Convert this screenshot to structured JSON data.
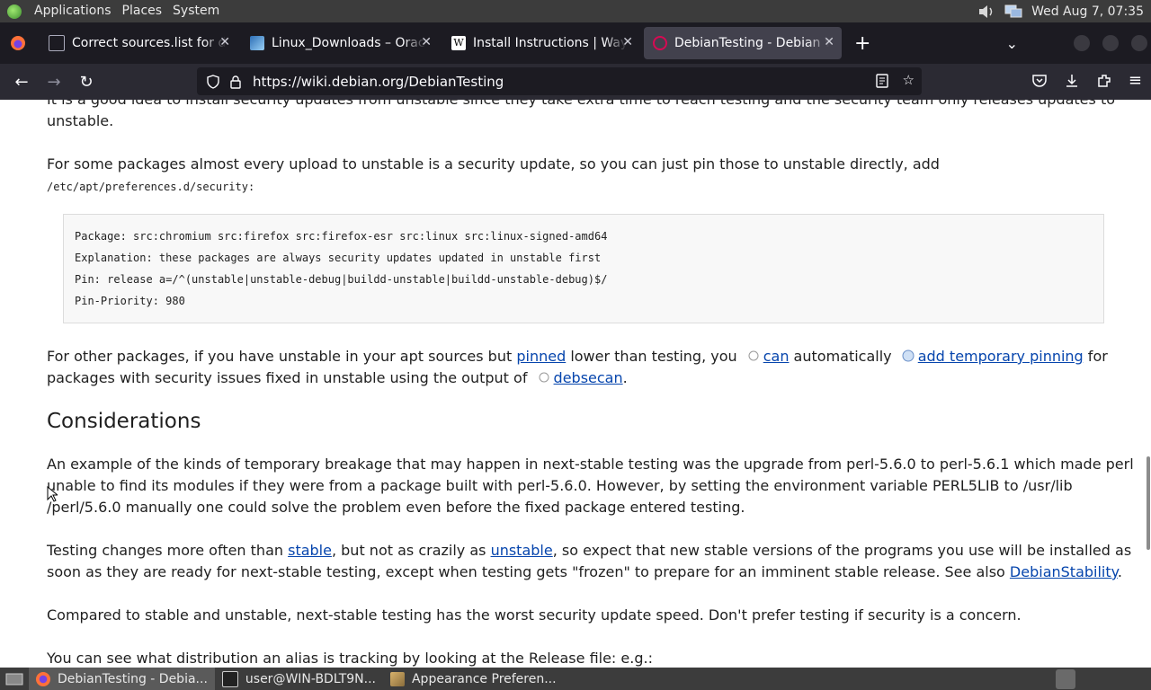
{
  "system_panel": {
    "menus": [
      "Applications",
      "Places",
      "System"
    ],
    "datetime": "Wed Aug 7, 07:35"
  },
  "tabs": [
    {
      "title": "Correct sources.list for de",
      "favicon": "generic-icon",
      "active": false
    },
    {
      "title": "Linux_Downloads – Oracle",
      "favicon": "virtualbox-icon",
      "active": false
    },
    {
      "title": "Install Instructions | Wayd",
      "favicon": "wikipedia-icon",
      "active": false
    },
    {
      "title": "DebianTesting - Debian W",
      "favicon": "debian-icon",
      "active": true
    }
  ],
  "url": "https://wiki.debian.org/DebianTesting",
  "content": {
    "p_intro": "It is a good idea to install security updates from unstable since they take extra time to reach testing and the security team only releases updates to",
    "p_intro2": "unstable.",
    "p_pin1": "For some packages almost every upload to unstable is a security update, so you can just pin those to unstable directly, add",
    "p_pin_path": "/etc/apt/preferences.d/security:",
    "code_lines": [
      "Package: src:chromium src:firefox src:firefox-esr src:linux src:linux-signed-amd64",
      "Explanation: these packages are always security updates updated in unstable first",
      "Pin: release a=/^(unstable|unstable-debug|buildd-unstable|buildd-unstable-debug)$/",
      "Pin-Priority: 980"
    ],
    "p_other_a": "For other packages, if you have unstable in your apt sources but ",
    "link_pinned": "pinned",
    "p_other_b": " lower than testing, you ",
    "link_can": "can",
    "p_other_c": " automatically ",
    "link_add_temp": "add temporary pinning",
    "p_other_d": " for",
    "p_other_e": "packages with security issues fixed in unstable using the output of ",
    "link_debsecan": "debsecan",
    "p_other_f": ".",
    "h_considerations": "Considerations",
    "p_example": "An example of the kinds of temporary breakage that may happen in next-stable testing was the upgrade from perl-5.6.0 to perl-5.6.1 which made perl unable to find its modules if they were from a package built with perl-5.6.0. However, by setting the environment variable PERL5LIB to /usr/lib /perl/5.6.0 manually one could solve the problem even before the fixed package entered testing.",
    "p_changes_a": "Testing changes more often than ",
    "link_stable": "stable",
    "p_changes_b": ", but not as crazily as ",
    "link_unstable": "unstable",
    "p_changes_c": ", so expect that new stable versions of the programs you use will be installed as soon as they are ready for next-stable testing, except when testing gets \"frozen\" to prepare for an imminent stable release. See also ",
    "link_stability": "DebianStability",
    "p_changes_d": ".",
    "p_compared": "Compared to stable and unstable, next-stable testing has the worst security update speed. Don't prefer testing if security is a concern.",
    "p_alias": "You can see what distribution an alias is tracking by looking at the Release file: e.g.:"
  },
  "taskbar": [
    {
      "label": "DebianTesting - Debia...",
      "icon": "firefox-icon",
      "active": true
    },
    {
      "label": "user@WIN-BDLT9N...",
      "icon": "terminal-icon",
      "active": false
    },
    {
      "label": "Appearance Preferen...",
      "icon": "appearance-icon",
      "active": false
    }
  ]
}
